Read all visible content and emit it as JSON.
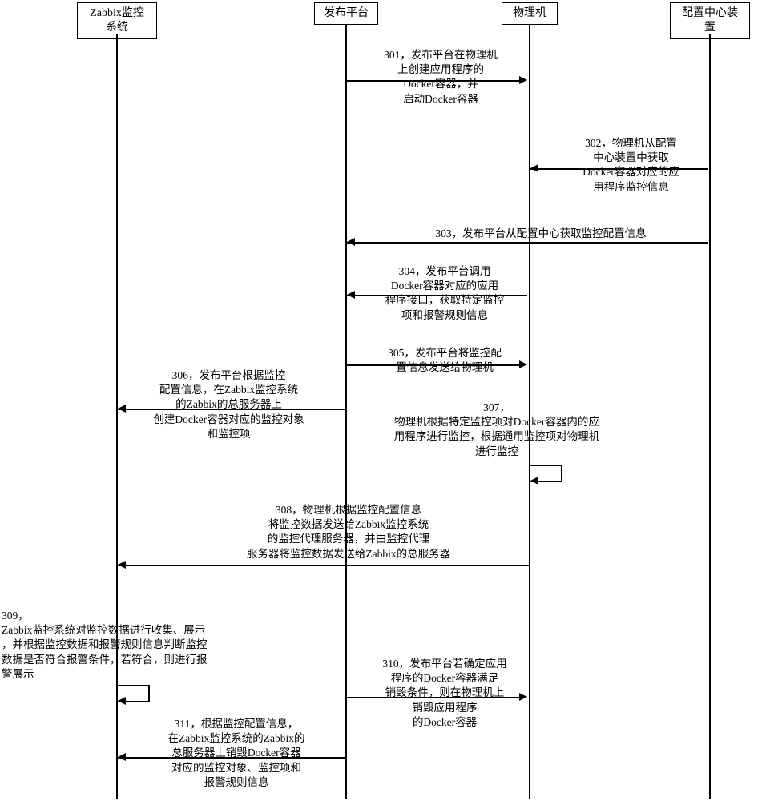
{
  "participants": {
    "zabbix": "Zabbix监控\n系统",
    "publish": "发布平台",
    "physical": "物理机",
    "config": "配置中心装\n置"
  },
  "messages": {
    "m301": "301，发布平台在物理机\n上创建应用程序的\nDocker容器，并\n启动Docker容器",
    "m302": "302，物理机从配置\n中心装置中获取\nDocker容器对应的应\n用程序监控信息",
    "m303": "303，发布平台从配置中心获取监控配置信息",
    "m304": "304，发布平台调用\nDocker容器对应的应用\n程序接口，获取特定监控\n项和报警规则信息",
    "m305": "305，发布平台将监控配\n置信息发送给物理机",
    "m306": "306，发布平台根据监控\n配置信息，在Zabbix监控系统\n的Zabbix的总服务器上\n创建Docker容器对应的监控对象\n和监控项",
    "m307": "307，\n物理机根据特定监控项对Docker容器内的应\n用程序进行监控，根据通用监控项对物理机\n进行监控",
    "m308": "308，物理机根据监控配置信息\n将监控数据发送给Zabbix监控系统\n的监控代理服务器，并由监控代理\n服务器将监控数据发送给Zabbix的总服务器",
    "m309": "309，\nZabbix监控系统对监控数据进行收集、展示\n，并根据监控数据和报警规则信息判断监控\n数据是否符合报警条件，若符合，则进行报\n警展示",
    "m310": "310，发布平台若确定应用\n程序的Docker容器满足\n销毁条件，则在物理机上\n销毁应用程序\n的Docker容器",
    "m311": "311，根据监控配置信息，\n在Zabbix监控系统的Zabbix的\n总服务器上销毁Docker容器\n对应的监控对象、监控项和\n报警规则信息"
  }
}
